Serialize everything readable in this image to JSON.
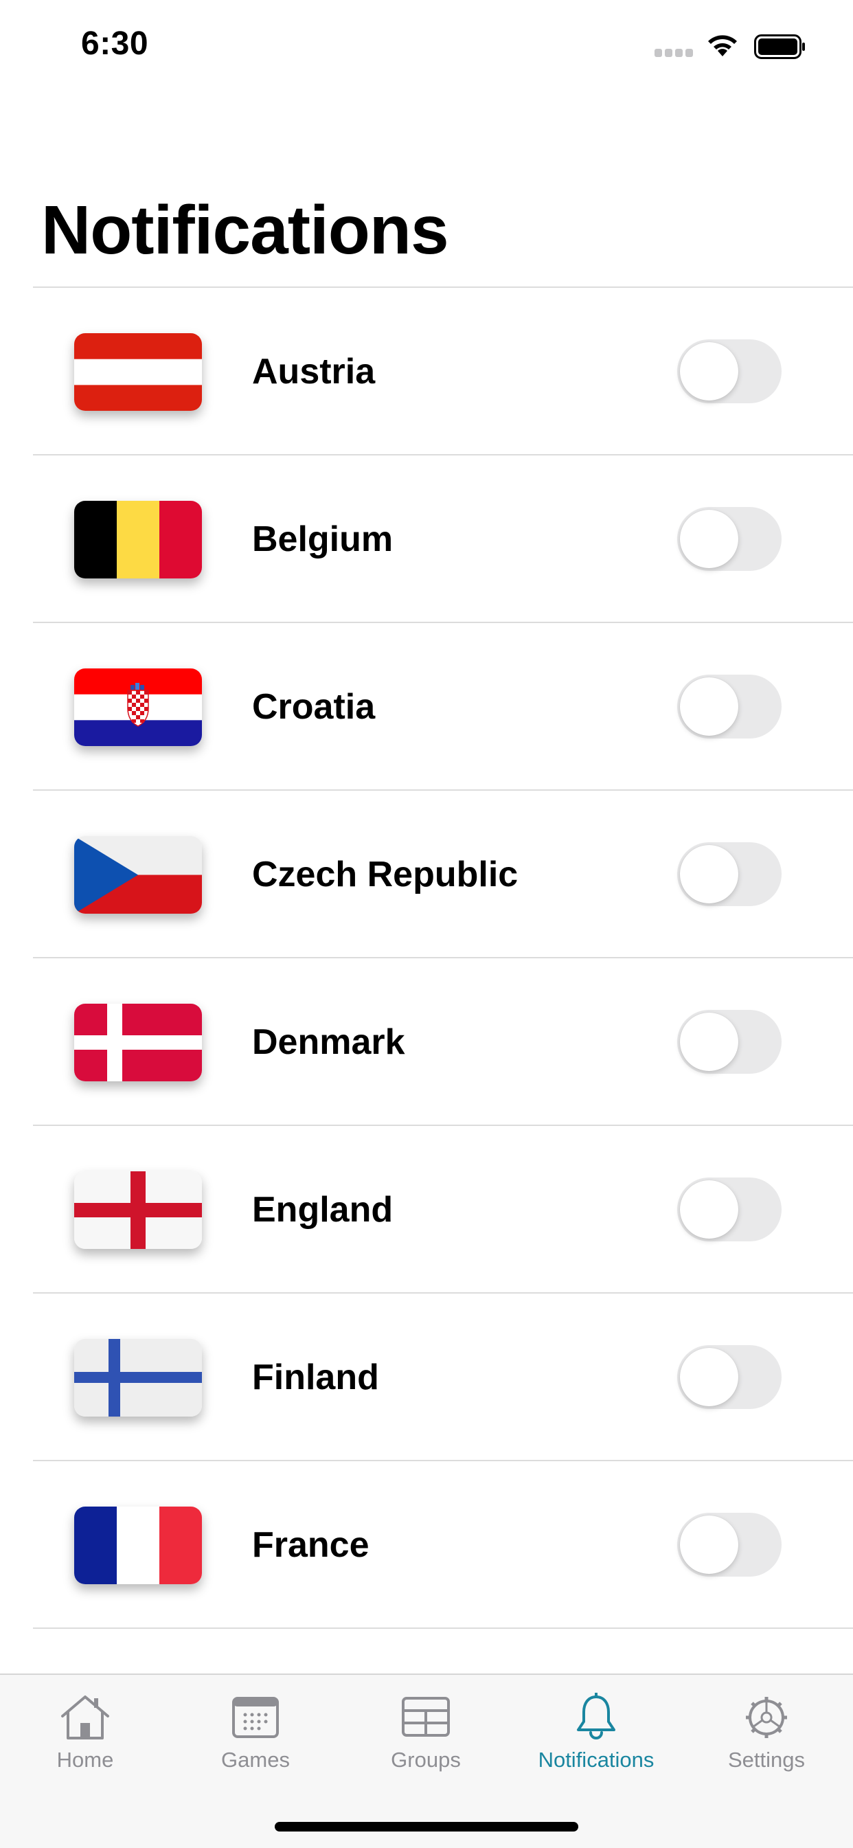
{
  "status_bar": {
    "time": "6:30"
  },
  "title": "Notifications",
  "countries": [
    {
      "name": "Austria",
      "flag_icon": "austria-flag-icon",
      "enabled": false
    },
    {
      "name": "Belgium",
      "flag_icon": "belgium-flag-icon",
      "enabled": false
    },
    {
      "name": "Croatia",
      "flag_icon": "croatia-flag-icon",
      "enabled": false
    },
    {
      "name": "Czech Republic",
      "flag_icon": "czech-republic-flag-icon",
      "enabled": false
    },
    {
      "name": "Denmark",
      "flag_icon": "denmark-flag-icon",
      "enabled": false
    },
    {
      "name": "England",
      "flag_icon": "england-flag-icon",
      "enabled": false
    },
    {
      "name": "Finland",
      "flag_icon": "finland-flag-icon",
      "enabled": false
    },
    {
      "name": "France",
      "flag_icon": "france-flag-icon",
      "enabled": false
    }
  ],
  "tabs": [
    {
      "label": "Home",
      "icon": "house-icon",
      "active": false
    },
    {
      "label": "Games",
      "icon": "calendar-icon",
      "active": false
    },
    {
      "label": "Groups",
      "icon": "table-icon",
      "active": false
    },
    {
      "label": "Notifications",
      "icon": "bell-icon",
      "active": true
    },
    {
      "label": "Settings",
      "icon": "gear-icon",
      "active": false
    }
  ],
  "colors": {
    "accent": "#1a86a0",
    "inactive_tab": "#8e8e93",
    "toggle_off": "#e9e9ea",
    "divider": "#dcdcdc"
  }
}
